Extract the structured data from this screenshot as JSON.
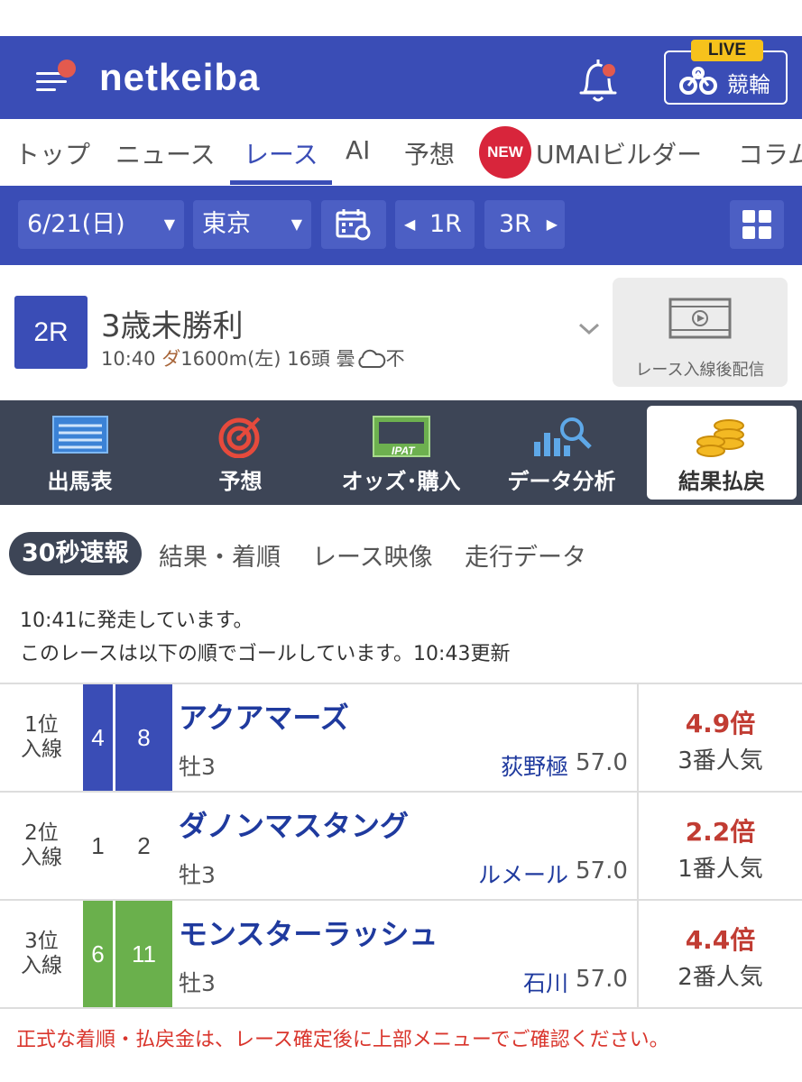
{
  "header": {
    "logo": "netkeiba",
    "live_tag": "LIVE",
    "live_label": "競輪"
  },
  "nav": {
    "items": [
      "トップ",
      "ニュース",
      "レース",
      "AI",
      "予想",
      "UMAIビルダー",
      "コラム"
    ],
    "new_badge": "NEW",
    "active": "レース"
  },
  "toolbar": {
    "date": "6/21(日)",
    "venue": "東京",
    "prev_race": "1R",
    "next_race": "3R"
  },
  "race": {
    "number": "2R",
    "title": "3歳未勝利",
    "time": "10:40",
    "surface": "ダ",
    "distance": "1600m(左)",
    "heads": "16頭",
    "weather": "曇",
    "track": "不",
    "video_label": "レース入線後配信"
  },
  "menu": {
    "items": [
      "出馬表",
      "予想",
      "オッズ･購入",
      "データ分析",
      "結果払戻"
    ],
    "active": "結果払戻"
  },
  "subtabs": {
    "items": [
      "30秒速報",
      "結果・着順",
      "レース映像",
      "走行データ"
    ],
    "active": "30秒速報"
  },
  "messages": {
    "start": "10:41に発走しています。",
    "goal": "このレースは以下の順でゴールしています。10:43更新"
  },
  "results": [
    {
      "rank_line1": "1位",
      "rank_line2": "入線",
      "waku": "4",
      "umaban": "8",
      "horse": "アクアマーズ",
      "sex_age": "牡3",
      "jockey": "荻野極",
      "weight": "57.0",
      "odds": "4.9倍",
      "popularity": "3番人気",
      "waku_color": "#3a4db6",
      "waku_text": "#ffffff"
    },
    {
      "rank_line1": "2位",
      "rank_line2": "入線",
      "waku": "1",
      "umaban": "2",
      "horse": "ダノンマスタング",
      "sex_age": "牡3",
      "jockey": "ルメール",
      "weight": "57.0",
      "odds": "2.2倍",
      "popularity": "1番人気",
      "waku_color": "#ffffff",
      "waku_text": "#444444"
    },
    {
      "rank_line1": "3位",
      "rank_line2": "入線",
      "waku": "6",
      "umaban": "11",
      "horse": "モンスターラッシュ",
      "sex_age": "牡3",
      "jockey": "石川",
      "weight": "57.0",
      "odds": "4.4倍",
      "popularity": "2番人気",
      "waku_color": "#6ab04c",
      "waku_text": "#ffffff"
    }
  ],
  "notice": "正式な着順・払戻金は、レース確定後に上部メニューでご確認ください。",
  "colors": {
    "brand": "#3a4db6",
    "menu_bg": "#3d4556",
    "odds_red": "#c13c33",
    "notice_red": "#d9352c"
  }
}
